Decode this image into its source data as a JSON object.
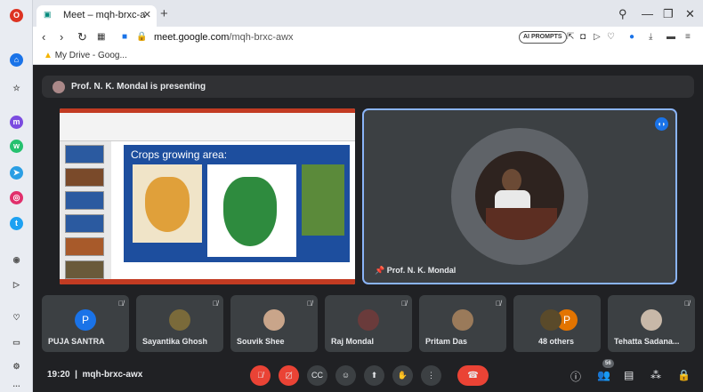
{
  "browser": {
    "tab_title": "Meet – mqh-brxc-a",
    "url_domain": "meet.google.com",
    "url_path": "/mqh-brxc-awx",
    "ai_prompts": "AI PROMPTS",
    "bookmark": "My Drive - Goog..."
  },
  "meet": {
    "presenting": "Prof. N. K. Mondal is presenting",
    "slide_title": "Crops growing area:",
    "speaker_name": "Prof. N. K. Mondal",
    "time": "19:20",
    "meeting_code": "mqh-brxc-awx",
    "participant_count": "56",
    "leave_label": "⏺",
    "participants": [
      {
        "name": "PUJA SANTRA",
        "initial": "P",
        "color": "#1a73e8"
      },
      {
        "name": "Sayantika Ghosh",
        "initial": "",
        "color": "#7a6a3a"
      },
      {
        "name": "Souvik Shee",
        "initial": "",
        "color": "#c9a58a"
      },
      {
        "name": "Raj Mondal",
        "initial": "",
        "color": "#6a3b3b"
      },
      {
        "name": "Pritam Das",
        "initial": "",
        "color": "#9a7a5a"
      },
      {
        "name": "48 others",
        "initial": "P",
        "color": "#e37400"
      },
      {
        "name": "Tehatta Sadana...",
        "initial": "",
        "color": "#c8b8a8"
      }
    ]
  },
  "colors": {
    "accent": "#8ab4f8",
    "leave": "#ea4335",
    "brand": "#1a73e8"
  }
}
